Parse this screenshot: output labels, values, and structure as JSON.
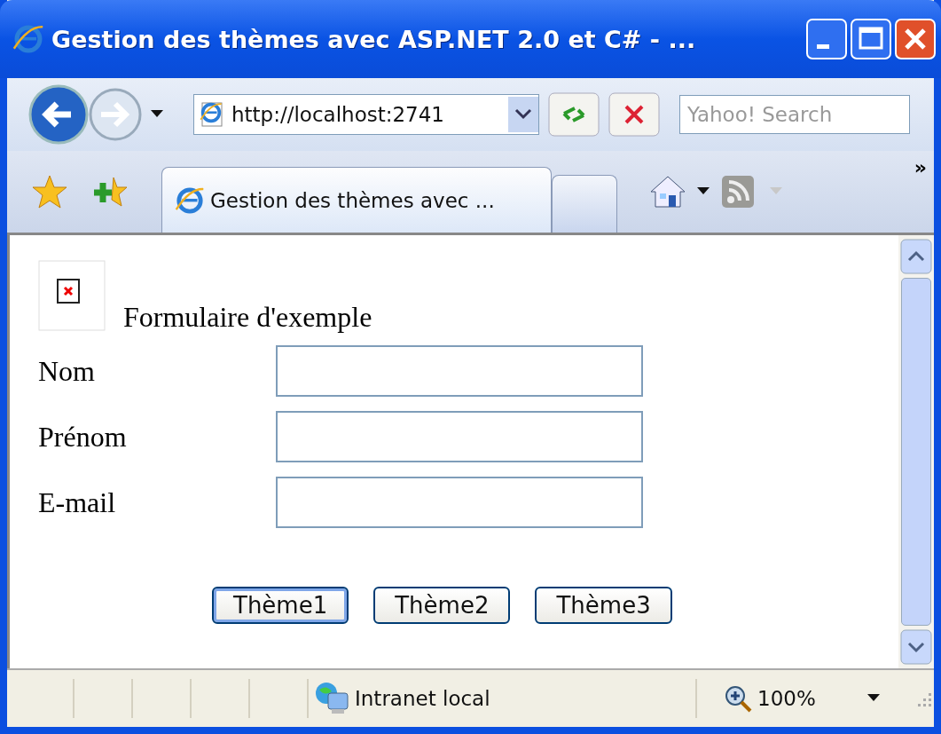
{
  "window": {
    "title": "Gestion des thèmes avec ASP.NET 2.0 et C# - ..."
  },
  "address_bar": {
    "value": "http://localhost:2741"
  },
  "search": {
    "placeholder": "Yahoo! Search"
  },
  "tabs": [
    {
      "label": "Gestion des thèmes avec ...",
      "selected": true
    }
  ],
  "toolbar_overflow": "»",
  "page": {
    "heading": "Formulaire d'exemple",
    "fields": [
      {
        "label": "Nom"
      },
      {
        "label": "Prénom"
      },
      {
        "label": "E-mail"
      }
    ],
    "buttons": [
      {
        "label": "Thème1",
        "focused": true
      },
      {
        "label": "Thème2",
        "focused": false
      },
      {
        "label": "Thème3",
        "focused": false
      }
    ]
  },
  "status_bar": {
    "zone": "Intranet local",
    "zoom": "100%"
  }
}
